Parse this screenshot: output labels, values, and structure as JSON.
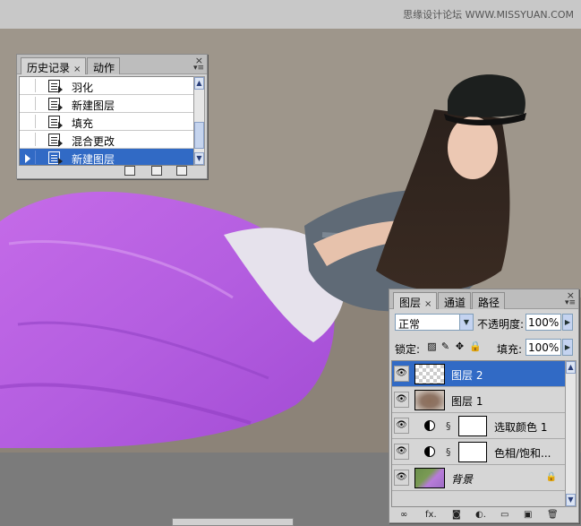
{
  "watermark": "思缘设计论坛 WWW.MISSYUAN.COM",
  "history_panel": {
    "tabs": [
      {
        "label": "历史记录",
        "close": "×"
      },
      {
        "label": "动作"
      }
    ],
    "close": "×",
    "menu": "▾≡",
    "items": [
      {
        "label": "羽化"
      },
      {
        "label": "新建图层"
      },
      {
        "label": "填充"
      },
      {
        "label": "混合更改"
      },
      {
        "label": "新建图层",
        "selected": true
      }
    ],
    "scroll_up": "▲",
    "scroll_down": "▼"
  },
  "layers_panel": {
    "tabs": [
      {
        "label": "图层",
        "close": "×"
      },
      {
        "label": "通道"
      },
      {
        "label": "路径"
      }
    ],
    "close": "×",
    "menu": "▾≡",
    "blend_mode": "正常",
    "opacity_label": "不透明度:",
    "opacity_value": "100%",
    "lock_label": "锁定:",
    "fill_label": "填充:",
    "fill_value": "100%",
    "layers": [
      {
        "name": "图层 2",
        "selected": true
      },
      {
        "name": "图层 1"
      },
      {
        "name": "选取颜色 1"
      },
      {
        "name": "色相/饱和..."
      },
      {
        "name": "背景"
      }
    ],
    "footer": [
      "∞",
      "fx.",
      "◙",
      "◐.",
      "▭",
      "▣",
      "🗑"
    ],
    "scroll_up": "▲",
    "scroll_down": "▼"
  }
}
